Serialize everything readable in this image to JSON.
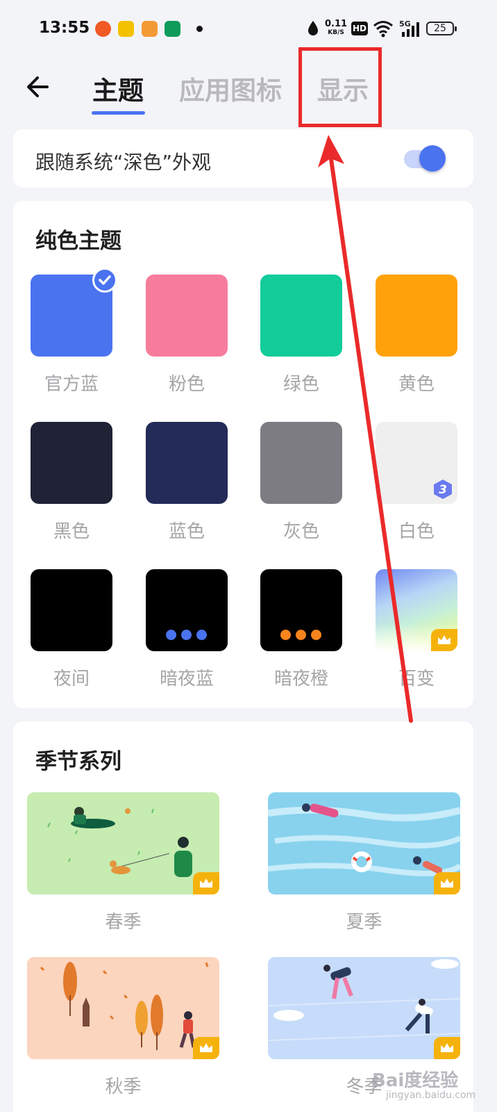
{
  "status_bar": {
    "time": "13:55",
    "net_speed_value": "0.11",
    "net_speed_unit": "KB/S",
    "hd_label": "HD",
    "network_label": "5G",
    "battery": "25"
  },
  "header": {
    "back_icon": "arrow-left-icon",
    "tabs": [
      {
        "label": "主题",
        "active": true
      },
      {
        "label": "应用图标",
        "active": false
      },
      {
        "label": "显示",
        "active": false
      }
    ]
  },
  "follow_system": {
    "label": "跟随系统“深色”外观",
    "enabled": true
  },
  "solid_themes": {
    "title": "纯色主题",
    "items": [
      {
        "label": "官方蓝",
        "color": "#4a73f0",
        "selected": true
      },
      {
        "label": "粉色",
        "color": "#f77c9c"
      },
      {
        "label": "绿色",
        "color": "#12cc9a"
      },
      {
        "label": "黄色",
        "color": "#ffa20a"
      },
      {
        "label": "黑色",
        "color": "#202336"
      },
      {
        "label": "蓝色",
        "color": "#232b58"
      },
      {
        "label": "灰色",
        "color": "#7c7c82"
      },
      {
        "label": "白色",
        "color": "#efefef",
        "badge": "3"
      },
      {
        "label": "夜间",
        "color": "#000000"
      },
      {
        "label": "暗夜蓝",
        "color": "#000000",
        "accent": "#4a73f0"
      },
      {
        "label": "暗夜橙",
        "color": "#000000",
        "accent": "#f7841c"
      },
      {
        "label": "百变",
        "color": "gradient",
        "premium": true
      }
    ]
  },
  "seasons": {
    "title": "季节系列",
    "items": [
      {
        "label": "春季",
        "premium": true
      },
      {
        "label": "夏季",
        "premium": true
      },
      {
        "label": "秋季",
        "premium": true
      },
      {
        "label": "冬季",
        "premium": true
      }
    ]
  },
  "watermark": {
    "brand": "Bai度经验",
    "url": "jingyan.baidu.com"
  },
  "colors": {
    "accent": "#4a73f0",
    "annotation": "#ea2a2a",
    "premium": "#f6b20c"
  }
}
